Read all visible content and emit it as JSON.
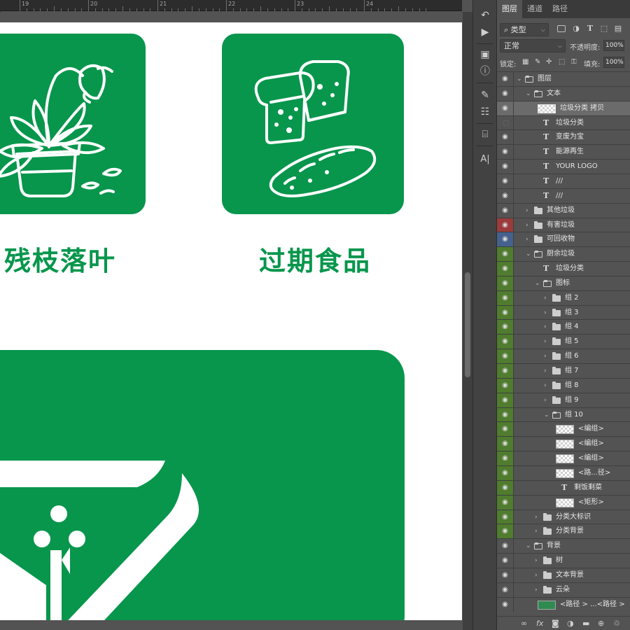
{
  "ruler": {
    "labels": [
      "19",
      "20",
      "21",
      "22",
      "23",
      "24"
    ]
  },
  "canvas": {
    "captions": {
      "left": "残枝落叶",
      "right": "过期食品"
    },
    "colors": {
      "brand_green": "#07964c",
      "artboard": "#ffffff"
    }
  },
  "toolstrip": {
    "tools": [
      "history-brush-icon",
      "play-icon",
      "3d-cube-icon",
      "info-icon",
      "brush-settings-icon",
      "adjust-icon",
      "stamp-icon",
      "character-icon"
    ],
    "text_tool_glyph": "A|"
  },
  "panel": {
    "tabs": [
      "图层",
      "通道",
      "路径"
    ],
    "filter": {
      "kind_label": "类型"
    },
    "blend": {
      "mode": "正常",
      "opacity_label": "不透明度:",
      "opacity_value": "100%"
    },
    "lock": {
      "lock_label": "锁定:",
      "fill_label": "填充:",
      "fill_value": "100%"
    },
    "layers": [
      {
        "name": "图层",
        "type": "folder",
        "open": true,
        "indent": 0,
        "eye": "normal"
      },
      {
        "name": "文本",
        "type": "folder",
        "open": true,
        "indent": 1,
        "eye": "normal"
      },
      {
        "name": "垃圾分类 拷贝",
        "type": "image",
        "indent": 2,
        "eye": "normal",
        "selected": true
      },
      {
        "name": "垃圾分类",
        "type": "text",
        "indent": 2,
        "eye": "hidden"
      },
      {
        "name": "变废为宝",
        "type": "text",
        "indent": 2,
        "eye": "normal"
      },
      {
        "name": "能源再生",
        "type": "text",
        "indent": 2,
        "eye": "normal"
      },
      {
        "name": "YOUR LOGO",
        "type": "text",
        "indent": 2,
        "eye": "normal"
      },
      {
        "name": "///",
        "type": "text",
        "indent": 2,
        "eye": "normal"
      },
      {
        "name": "///",
        "type": "text",
        "indent": 2,
        "eye": "normal"
      },
      {
        "name": "其他垃圾",
        "type": "folder",
        "open": false,
        "indent": 1,
        "eye": "normal"
      },
      {
        "name": "有害垃圾",
        "type": "folder",
        "open": false,
        "indent": 1,
        "eye": "red"
      },
      {
        "name": "可回收物",
        "type": "folder",
        "open": false,
        "indent": 1,
        "eye": "blue"
      },
      {
        "name": "厨余垃圾",
        "type": "folder",
        "open": true,
        "indent": 1,
        "eye": "green"
      },
      {
        "name": "垃圾分类",
        "type": "text",
        "indent": 2,
        "eye": "green"
      },
      {
        "name": "图标",
        "type": "folder",
        "open": true,
        "indent": 2,
        "eye": "green"
      },
      {
        "name": "组 2",
        "type": "folder",
        "open": false,
        "indent": 3,
        "eye": "green"
      },
      {
        "name": "组 3",
        "type": "folder",
        "open": false,
        "indent": 3,
        "eye": "green"
      },
      {
        "name": "组 4",
        "type": "folder",
        "open": false,
        "indent": 3,
        "eye": "green"
      },
      {
        "name": "组 5",
        "type": "folder",
        "open": false,
        "indent": 3,
        "eye": "green"
      },
      {
        "name": "组 6",
        "type": "folder",
        "open": false,
        "indent": 3,
        "eye": "green"
      },
      {
        "name": "组 7",
        "type": "folder",
        "open": false,
        "indent": 3,
        "eye": "green"
      },
      {
        "name": "组 8",
        "type": "folder",
        "open": false,
        "indent": 3,
        "eye": "green"
      },
      {
        "name": "组 9",
        "type": "folder",
        "open": false,
        "indent": 3,
        "eye": "green"
      },
      {
        "name": "组 10",
        "type": "folder",
        "open": true,
        "indent": 3,
        "eye": "green"
      },
      {
        "name": "<编组>",
        "type": "image",
        "indent": 4,
        "eye": "green"
      },
      {
        "name": "<编组>",
        "type": "image",
        "indent": 4,
        "eye": "green"
      },
      {
        "name": "<编组>",
        "type": "image",
        "indent": 4,
        "eye": "green"
      },
      {
        "name": "<路...径>",
        "type": "image",
        "indent": 4,
        "eye": "green"
      },
      {
        "name": "剩饭剩菜",
        "type": "text",
        "indent": 4,
        "eye": "green"
      },
      {
        "name": "<矩形>",
        "type": "image",
        "indent": 4,
        "eye": "green"
      },
      {
        "name": "分类大标识",
        "type": "folder",
        "open": false,
        "indent": 2,
        "eye": "green"
      },
      {
        "name": "分类背景",
        "type": "folder",
        "open": false,
        "indent": 2,
        "eye": "green"
      },
      {
        "name": "背景",
        "type": "folder",
        "open": true,
        "indent": 1,
        "eye": "normal"
      },
      {
        "name": "树",
        "type": "folder",
        "open": false,
        "indent": 2,
        "eye": "normal"
      },
      {
        "name": "文本背景",
        "type": "folder",
        "open": false,
        "indent": 2,
        "eye": "normal"
      },
      {
        "name": "云朵",
        "type": "folder",
        "open": false,
        "indent": 2,
        "eye": "normal"
      },
      {
        "name": "<路径 > ...<路径 >",
        "type": "image-green",
        "indent": 2,
        "eye": "normal"
      }
    ],
    "footer_icons": [
      "link-icon",
      "fx-icon",
      "mask-icon",
      "adjustment-icon",
      "new-group-icon",
      "new-layer-icon",
      "trash-icon"
    ]
  }
}
